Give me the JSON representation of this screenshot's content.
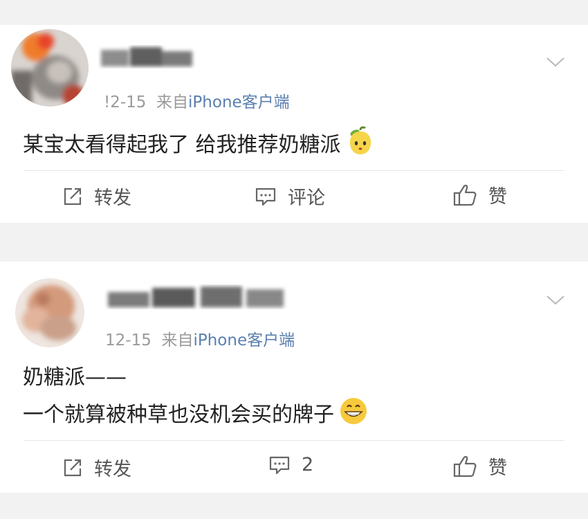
{
  "colors": {
    "background": "#ffffff",
    "separator": "#f2f2f2",
    "source_link": "#5a7fb0",
    "meta_gray": "#9a9a9a"
  },
  "posts": [
    {
      "date": "!2-15",
      "from_label": "来自",
      "source": "iPhone客户端",
      "text_lines": [
        "某宝太看得起我了 给我推荐奶糖派"
      ],
      "emoji": "pear-emoji",
      "actions": {
        "repost": "转发",
        "comment": "评论",
        "like": "赞"
      }
    },
    {
      "date": "12-15",
      "from_label": "来自",
      "source": "iPhone客户端",
      "text_lines": [
        "奶糖派——",
        "一个就算被种草也没机会买的牌子"
      ],
      "emoji": "grin-emoji",
      "actions": {
        "repost": "转发",
        "comment": "2",
        "like": "赞"
      }
    }
  ]
}
